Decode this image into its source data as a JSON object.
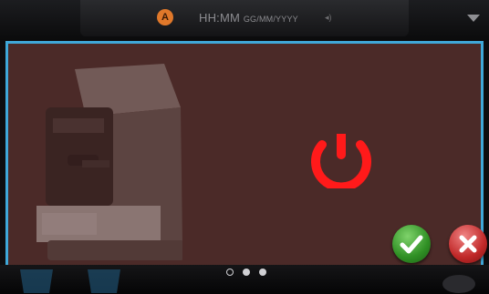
{
  "status_bar": {
    "time": "HH:MM",
    "date": "GG/MM/YYYY",
    "alert_icon": "warning-icon",
    "alert_glyph": "A"
  },
  "dialog": {
    "icon": "power-icon",
    "icon_color": "#ff1a1a",
    "background": "#4b2a28",
    "border_color": "#3fa8d9"
  },
  "actions": {
    "confirm_icon": "check-icon",
    "cancel_icon": "x-icon"
  },
  "pagination": {
    "total": 3,
    "current": 1
  }
}
